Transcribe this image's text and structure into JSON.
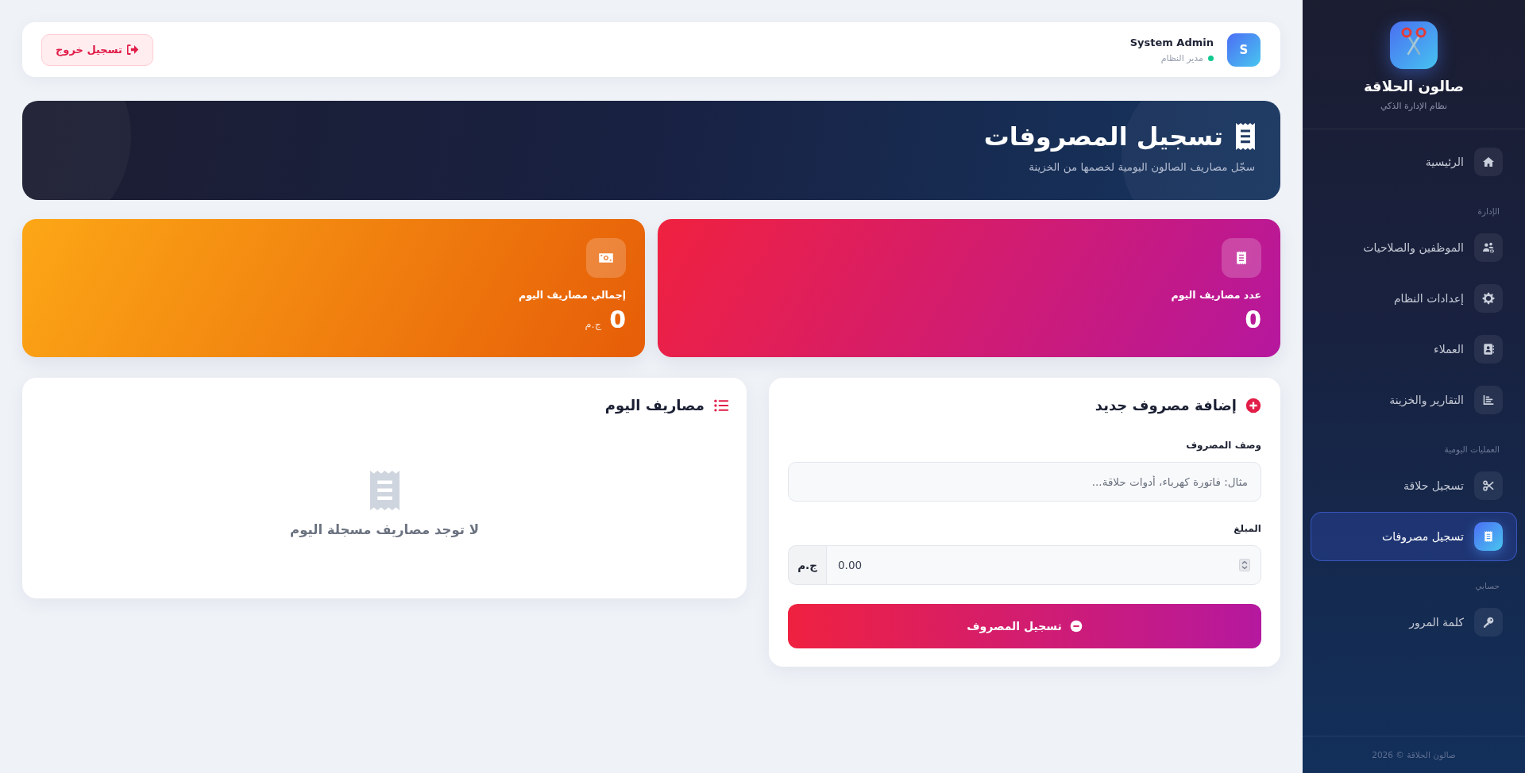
{
  "sidebar": {
    "brand_title": "صالون الحلاقة",
    "brand_subtitle": "نظام الإدارة الذكي",
    "sections": [
      {
        "items": [
          {
            "label": "الرئيسية",
            "selected": false
          }
        ]
      },
      {
        "title": "الإدارة",
        "items": [
          {
            "label": "الموظفين والصلاحيات",
            "selected": false
          },
          {
            "label": "إعدادات النظام",
            "selected": false
          },
          {
            "label": "العملاء",
            "selected": false
          },
          {
            "label": "التقارير والخزينة",
            "selected": false
          }
        ]
      },
      {
        "title": "العمليات اليومية",
        "items": [
          {
            "label": "تسجيل حلاقة",
            "selected": false
          },
          {
            "label": "تسجيل مصروفات",
            "selected": true
          }
        ]
      },
      {
        "title": "حسابي",
        "items": [
          {
            "label": "كلمة المرور",
            "selected": false
          }
        ]
      }
    ],
    "footer": "صالون الحلاقة © 2026"
  },
  "top_bar": {
    "avatar_letter": "S",
    "user_name": "System Admin",
    "user_role": "مدير النظام",
    "online": true,
    "logout_button": "تسجيل خروج"
  },
  "header": {
    "title": "تسجيل المصروفات",
    "subtitle": "سجّل مصاريف الصالون اليومية لخصمها من الخزينة"
  },
  "stats": [
    {
      "kind": "count",
      "label": "عدد مصاريف اليوم",
      "value": "0"
    },
    {
      "kind": "total",
      "label": "إجمالي مصاريف اليوم",
      "value": "0",
      "unit": "ج.م"
    }
  ],
  "expense_form": {
    "title": "إضافة مصروف جديد",
    "fields": [
      {
        "kind": "text",
        "label": "وصف المصروف",
        "placeholder": "مثال: فاتورة كهرباء، أدوات حلاقة..."
      },
      {
        "kind": "amount",
        "label": "المبلغ",
        "value": "0.00",
        "addon": "ج.م"
      }
    ],
    "submit_button": "تسجيل المصروف"
  },
  "today_expenses": {
    "title": "مصاريف اليوم",
    "empty_message": "لا توجد مصاريف مسجلة اليوم"
  }
}
